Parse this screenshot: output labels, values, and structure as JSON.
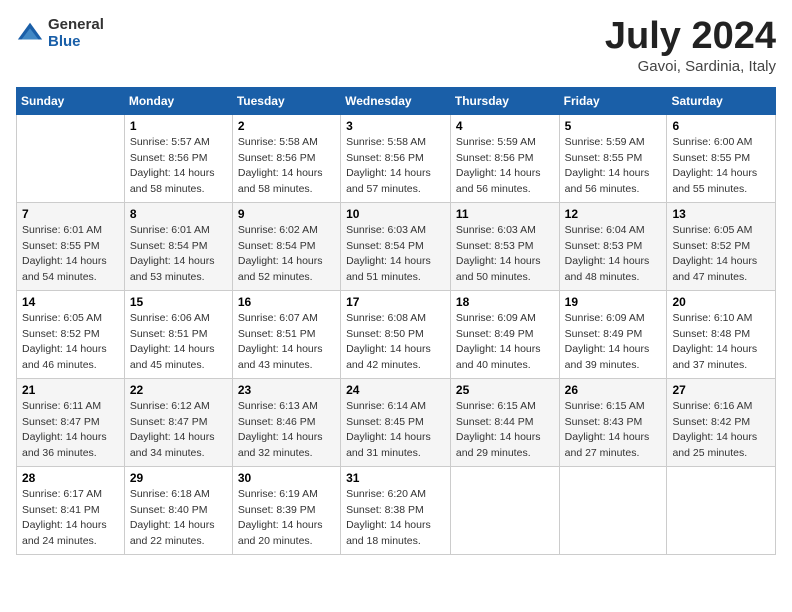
{
  "header": {
    "logo_general": "General",
    "logo_blue": "Blue",
    "month_year": "July 2024",
    "location": "Gavoi, Sardinia, Italy"
  },
  "days_of_week": [
    "Sunday",
    "Monday",
    "Tuesday",
    "Wednesday",
    "Thursday",
    "Friday",
    "Saturday"
  ],
  "weeks": [
    [
      {
        "day": "",
        "sunrise": "",
        "sunset": "",
        "daylight": ""
      },
      {
        "day": "1",
        "sunrise": "Sunrise: 5:57 AM",
        "sunset": "Sunset: 8:56 PM",
        "daylight": "Daylight: 14 hours and 58 minutes."
      },
      {
        "day": "2",
        "sunrise": "Sunrise: 5:58 AM",
        "sunset": "Sunset: 8:56 PM",
        "daylight": "Daylight: 14 hours and 58 minutes."
      },
      {
        "day": "3",
        "sunrise": "Sunrise: 5:58 AM",
        "sunset": "Sunset: 8:56 PM",
        "daylight": "Daylight: 14 hours and 57 minutes."
      },
      {
        "day": "4",
        "sunrise": "Sunrise: 5:59 AM",
        "sunset": "Sunset: 8:56 PM",
        "daylight": "Daylight: 14 hours and 56 minutes."
      },
      {
        "day": "5",
        "sunrise": "Sunrise: 5:59 AM",
        "sunset": "Sunset: 8:55 PM",
        "daylight": "Daylight: 14 hours and 56 minutes."
      },
      {
        "day": "6",
        "sunrise": "Sunrise: 6:00 AM",
        "sunset": "Sunset: 8:55 PM",
        "daylight": "Daylight: 14 hours and 55 minutes."
      }
    ],
    [
      {
        "day": "7",
        "sunrise": "Sunrise: 6:01 AM",
        "sunset": "Sunset: 8:55 PM",
        "daylight": "Daylight: 14 hours and 54 minutes."
      },
      {
        "day": "8",
        "sunrise": "Sunrise: 6:01 AM",
        "sunset": "Sunset: 8:54 PM",
        "daylight": "Daylight: 14 hours and 53 minutes."
      },
      {
        "day": "9",
        "sunrise": "Sunrise: 6:02 AM",
        "sunset": "Sunset: 8:54 PM",
        "daylight": "Daylight: 14 hours and 52 minutes."
      },
      {
        "day": "10",
        "sunrise": "Sunrise: 6:03 AM",
        "sunset": "Sunset: 8:54 PM",
        "daylight": "Daylight: 14 hours and 51 minutes."
      },
      {
        "day": "11",
        "sunrise": "Sunrise: 6:03 AM",
        "sunset": "Sunset: 8:53 PM",
        "daylight": "Daylight: 14 hours and 50 minutes."
      },
      {
        "day": "12",
        "sunrise": "Sunrise: 6:04 AM",
        "sunset": "Sunset: 8:53 PM",
        "daylight": "Daylight: 14 hours and 48 minutes."
      },
      {
        "day": "13",
        "sunrise": "Sunrise: 6:05 AM",
        "sunset": "Sunset: 8:52 PM",
        "daylight": "Daylight: 14 hours and 47 minutes."
      }
    ],
    [
      {
        "day": "14",
        "sunrise": "Sunrise: 6:05 AM",
        "sunset": "Sunset: 8:52 PM",
        "daylight": "Daylight: 14 hours and 46 minutes."
      },
      {
        "day": "15",
        "sunrise": "Sunrise: 6:06 AM",
        "sunset": "Sunset: 8:51 PM",
        "daylight": "Daylight: 14 hours and 45 minutes."
      },
      {
        "day": "16",
        "sunrise": "Sunrise: 6:07 AM",
        "sunset": "Sunset: 8:51 PM",
        "daylight": "Daylight: 14 hours and 43 minutes."
      },
      {
        "day": "17",
        "sunrise": "Sunrise: 6:08 AM",
        "sunset": "Sunset: 8:50 PM",
        "daylight": "Daylight: 14 hours and 42 minutes."
      },
      {
        "day": "18",
        "sunrise": "Sunrise: 6:09 AM",
        "sunset": "Sunset: 8:49 PM",
        "daylight": "Daylight: 14 hours and 40 minutes."
      },
      {
        "day": "19",
        "sunrise": "Sunrise: 6:09 AM",
        "sunset": "Sunset: 8:49 PM",
        "daylight": "Daylight: 14 hours and 39 minutes."
      },
      {
        "day": "20",
        "sunrise": "Sunrise: 6:10 AM",
        "sunset": "Sunset: 8:48 PM",
        "daylight": "Daylight: 14 hours and 37 minutes."
      }
    ],
    [
      {
        "day": "21",
        "sunrise": "Sunrise: 6:11 AM",
        "sunset": "Sunset: 8:47 PM",
        "daylight": "Daylight: 14 hours and 36 minutes."
      },
      {
        "day": "22",
        "sunrise": "Sunrise: 6:12 AM",
        "sunset": "Sunset: 8:47 PM",
        "daylight": "Daylight: 14 hours and 34 minutes."
      },
      {
        "day": "23",
        "sunrise": "Sunrise: 6:13 AM",
        "sunset": "Sunset: 8:46 PM",
        "daylight": "Daylight: 14 hours and 32 minutes."
      },
      {
        "day": "24",
        "sunrise": "Sunrise: 6:14 AM",
        "sunset": "Sunset: 8:45 PM",
        "daylight": "Daylight: 14 hours and 31 minutes."
      },
      {
        "day": "25",
        "sunrise": "Sunrise: 6:15 AM",
        "sunset": "Sunset: 8:44 PM",
        "daylight": "Daylight: 14 hours and 29 minutes."
      },
      {
        "day": "26",
        "sunrise": "Sunrise: 6:15 AM",
        "sunset": "Sunset: 8:43 PM",
        "daylight": "Daylight: 14 hours and 27 minutes."
      },
      {
        "day": "27",
        "sunrise": "Sunrise: 6:16 AM",
        "sunset": "Sunset: 8:42 PM",
        "daylight": "Daylight: 14 hours and 25 minutes."
      }
    ],
    [
      {
        "day": "28",
        "sunrise": "Sunrise: 6:17 AM",
        "sunset": "Sunset: 8:41 PM",
        "daylight": "Daylight: 14 hours and 24 minutes."
      },
      {
        "day": "29",
        "sunrise": "Sunrise: 6:18 AM",
        "sunset": "Sunset: 8:40 PM",
        "daylight": "Daylight: 14 hours and 22 minutes."
      },
      {
        "day": "30",
        "sunrise": "Sunrise: 6:19 AM",
        "sunset": "Sunset: 8:39 PM",
        "daylight": "Daylight: 14 hours and 20 minutes."
      },
      {
        "day": "31",
        "sunrise": "Sunrise: 6:20 AM",
        "sunset": "Sunset: 8:38 PM",
        "daylight": "Daylight: 14 hours and 18 minutes."
      },
      {
        "day": "",
        "sunrise": "",
        "sunset": "",
        "daylight": ""
      },
      {
        "day": "",
        "sunrise": "",
        "sunset": "",
        "daylight": ""
      },
      {
        "day": "",
        "sunrise": "",
        "sunset": "",
        "daylight": ""
      }
    ]
  ]
}
